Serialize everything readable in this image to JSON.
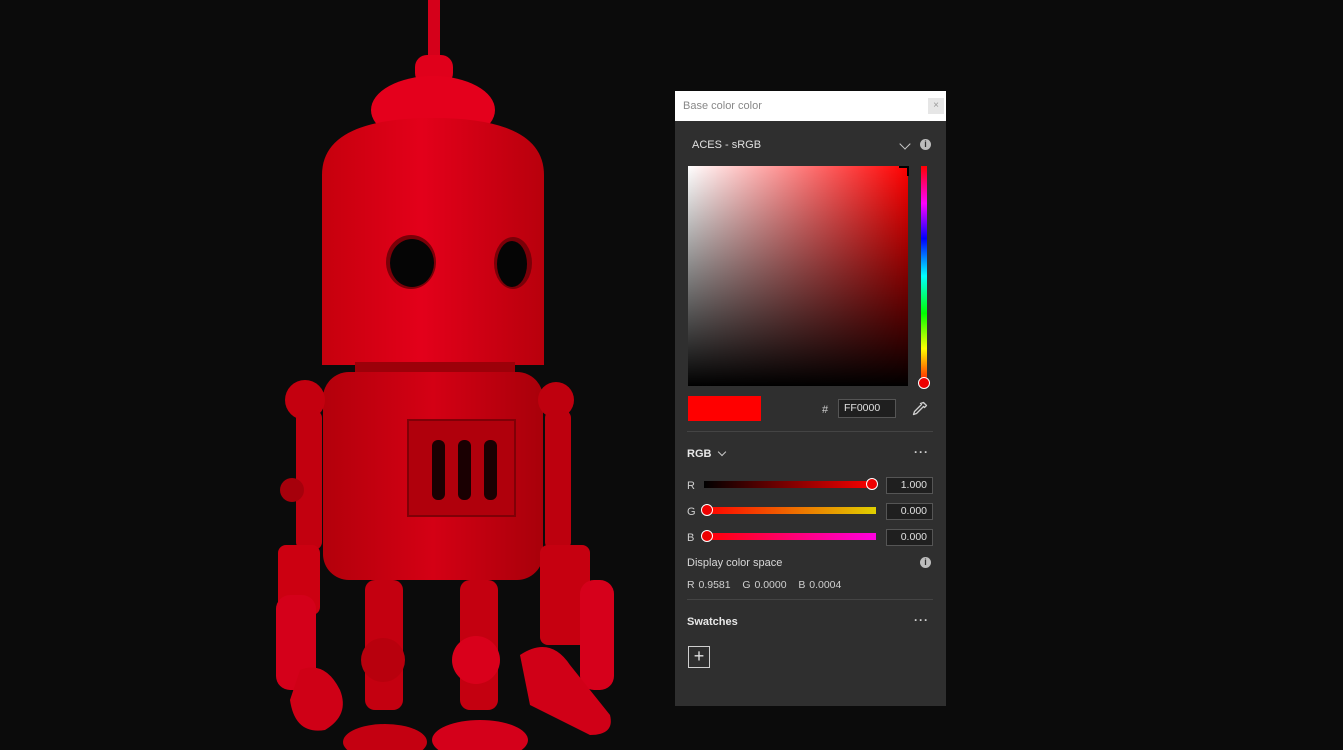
{
  "panel": {
    "title": "Base color color",
    "close_glyph": "×",
    "color_space": "ACES - sRGB",
    "hex_prefix": "#",
    "hex_value": "FF0000",
    "preview_color": "#ff0000",
    "rgb_section": {
      "title": "RGB",
      "channels": [
        {
          "label": "R",
          "value": "1.000",
          "fraction": 1.0
        },
        {
          "label": "G",
          "value": "0.000",
          "fraction": 0.0
        },
        {
          "label": "B",
          "value": "0.000",
          "fraction": 0.0
        }
      ]
    },
    "display_color_space": {
      "label": "Display color space",
      "values": "R 0.9581   G 0.0000   B 0.0004"
    },
    "swatches": {
      "title": "Swatches",
      "add_glyph": "+"
    },
    "more_glyph": "···",
    "info_glyph": "i"
  },
  "colors": {
    "accent": "#ff0000",
    "panel_bg": "#2f2f2f",
    "viewport_bg": "#0b0b0b"
  },
  "icons": [
    "chevron-down-icon",
    "info-icon",
    "eyedropper-icon",
    "more-icon",
    "close-icon",
    "plus-icon"
  ]
}
